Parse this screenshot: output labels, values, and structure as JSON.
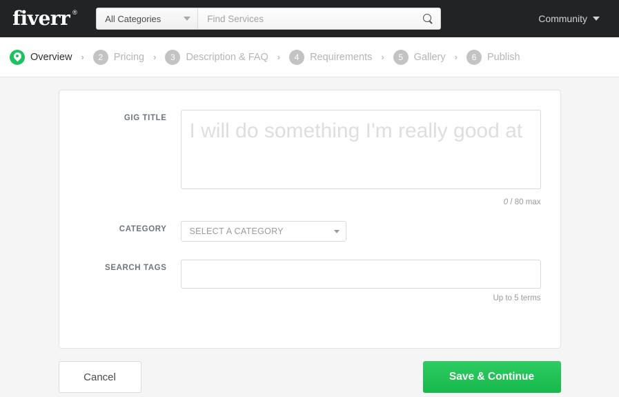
{
  "nav": {
    "logo_text": "fiverr",
    "logo_mark": "®",
    "category_select": "All Categories",
    "search_placeholder": "Find Services",
    "search_value": "",
    "community_label": "Community"
  },
  "steps": [
    {
      "num": "",
      "label": "Overview",
      "active": true
    },
    {
      "num": "2",
      "label": "Pricing",
      "active": false
    },
    {
      "num": "3",
      "label": "Description & FAQ",
      "active": false
    },
    {
      "num": "4",
      "label": "Requirements",
      "active": false
    },
    {
      "num": "5",
      "label": "Gallery",
      "active": false
    },
    {
      "num": "6",
      "label": "Publish",
      "active": false
    }
  ],
  "separator": "›",
  "form": {
    "gig_title": {
      "label": "GIG TITLE",
      "value": "",
      "placeholder": "I will do something I'm really good at",
      "counter_count": "0",
      "counter_suffix": "/ 80 max"
    },
    "category": {
      "label": "CATEGORY",
      "selected": "SELECT A CATEGORY"
    },
    "search_tags": {
      "label": "SEARCH TAGS",
      "value": "",
      "placeholder": "",
      "hint": "Up to 5 terms"
    }
  },
  "actions": {
    "cancel_label": "Cancel",
    "save_label": "Save & Continue"
  },
  "colors": {
    "brand_green": "#21c063",
    "nav_dark": "#222325",
    "page_bg": "#f5f5f5",
    "label_gray": "#6d7680",
    "placeholder_gray": "#dedede"
  }
}
